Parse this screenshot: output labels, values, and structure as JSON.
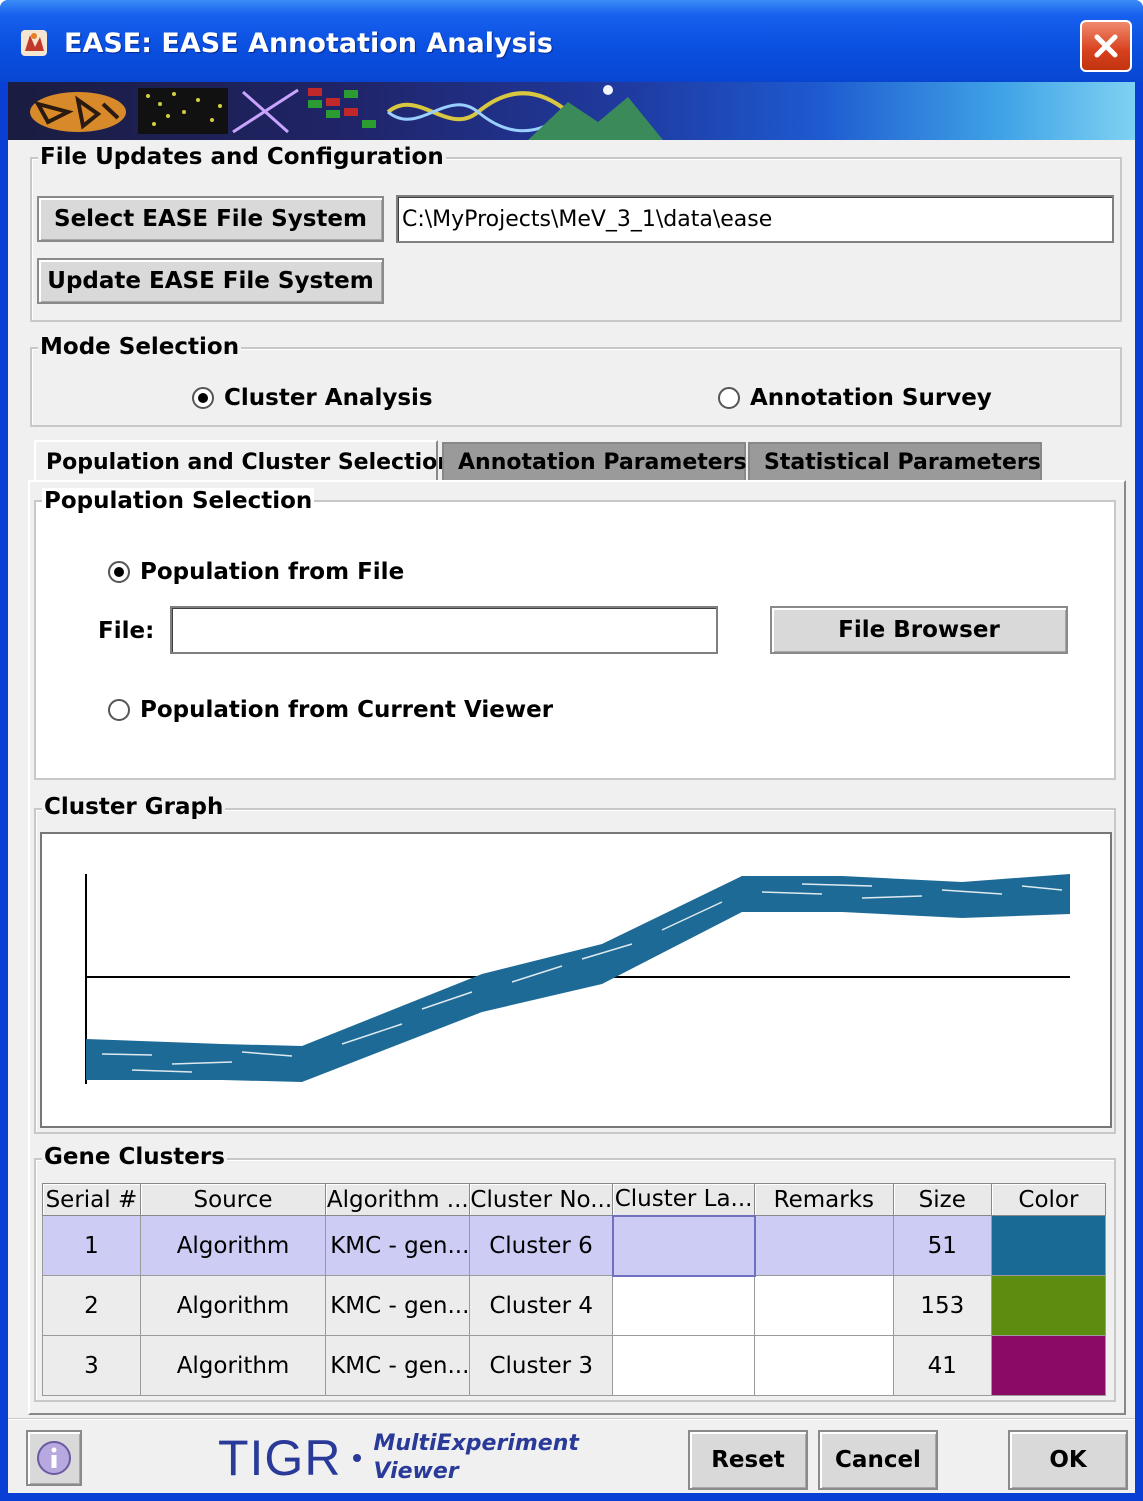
{
  "window": {
    "title": "EASE: EASE Annotation Analysis"
  },
  "file_updates": {
    "title": "File Updates and Configuration",
    "select_label": "Select EASE File System",
    "path_value": "C:\\MyProjects\\MeV_3_1\\data\\ease",
    "update_label": "Update EASE File System"
  },
  "mode": {
    "title": "Mode Selection",
    "options": [
      {
        "label": "Cluster Analysis",
        "selected": true
      },
      {
        "label": "Annotation Survey",
        "selected": false
      }
    ]
  },
  "tabs": [
    {
      "label": "Population and Cluster Selection",
      "active": true
    },
    {
      "label": "Annotation Parameters",
      "active": false
    },
    {
      "label": "Statistical Parameters",
      "active": false
    }
  ],
  "population": {
    "title": "Population Selection",
    "from_file_label": "Population from File",
    "from_file_selected": true,
    "file_label": "File:",
    "file_value": "",
    "browse_label": "File Browser",
    "from_viewer_label": "Population from Current Viewer",
    "from_viewer_selected": false
  },
  "cluster_graph": {
    "title": "Cluster Graph",
    "series_color": "#1d6a96"
  },
  "gene_clusters": {
    "title": "Gene Clusters",
    "columns": [
      "Serial #",
      "Source",
      "Algorithm ...",
      "Cluster No...",
      "Cluster La...",
      "Remarks",
      "Size",
      "Color"
    ],
    "rows": [
      {
        "serial": "1",
        "source": "Algorithm",
        "algorithm": "KMC - gen...",
        "cluster_no": "Cluster 6",
        "label": "",
        "remarks": "",
        "size": "51",
        "color": "#1a6a96",
        "selected": true
      },
      {
        "serial": "2",
        "source": "Algorithm",
        "algorithm": "KMC - gen...",
        "cluster_no": "Cluster 4",
        "label": "",
        "remarks": "",
        "size": "153",
        "color": "#5c8c10",
        "selected": false
      },
      {
        "serial": "3",
        "source": "Algorithm",
        "algorithm": "KMC - gen...",
        "cluster_no": "Cluster 3",
        "label": "",
        "remarks": "",
        "size": "41",
        "color": "#8a0a66",
        "selected": false
      }
    ]
  },
  "footer": {
    "logo_text": "TIGR",
    "logo_sub1": "MultiExperiment",
    "logo_sub2": "Viewer",
    "reset_label": "Reset",
    "cancel_label": "Cancel",
    "ok_label": "OK"
  }
}
